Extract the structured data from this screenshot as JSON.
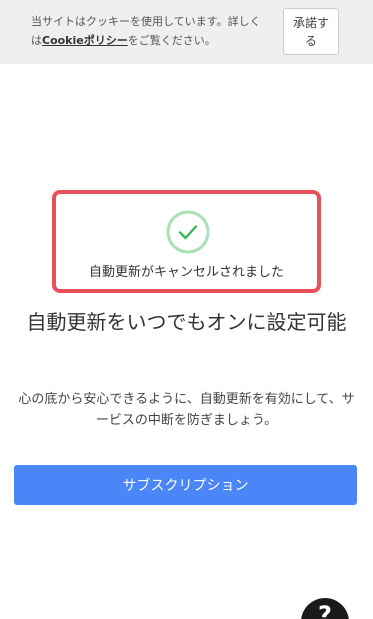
{
  "cookie_banner": {
    "text_before": "当サイトはクッキーを使用しています。詳しくは",
    "link_label": "Cookieポリシー",
    "text_after": "をご覧ください。",
    "accept_label": "承諾する"
  },
  "status": {
    "icon": "check-circle-icon",
    "message": "自動更新がキャンセルされました",
    "border_color": "#e8505b",
    "icon_color": "#3cb55c"
  },
  "main": {
    "headline": "自動更新をいつでもオンに設定可能",
    "description": "心の底から安心できるように、自動更新を有効にして、サービスの中断を防ぎましょう。",
    "subscribe_label": "サブスクリプション",
    "button_color": "#4a86f7"
  },
  "help": {
    "icon": "question-icon",
    "glyph": "?"
  }
}
